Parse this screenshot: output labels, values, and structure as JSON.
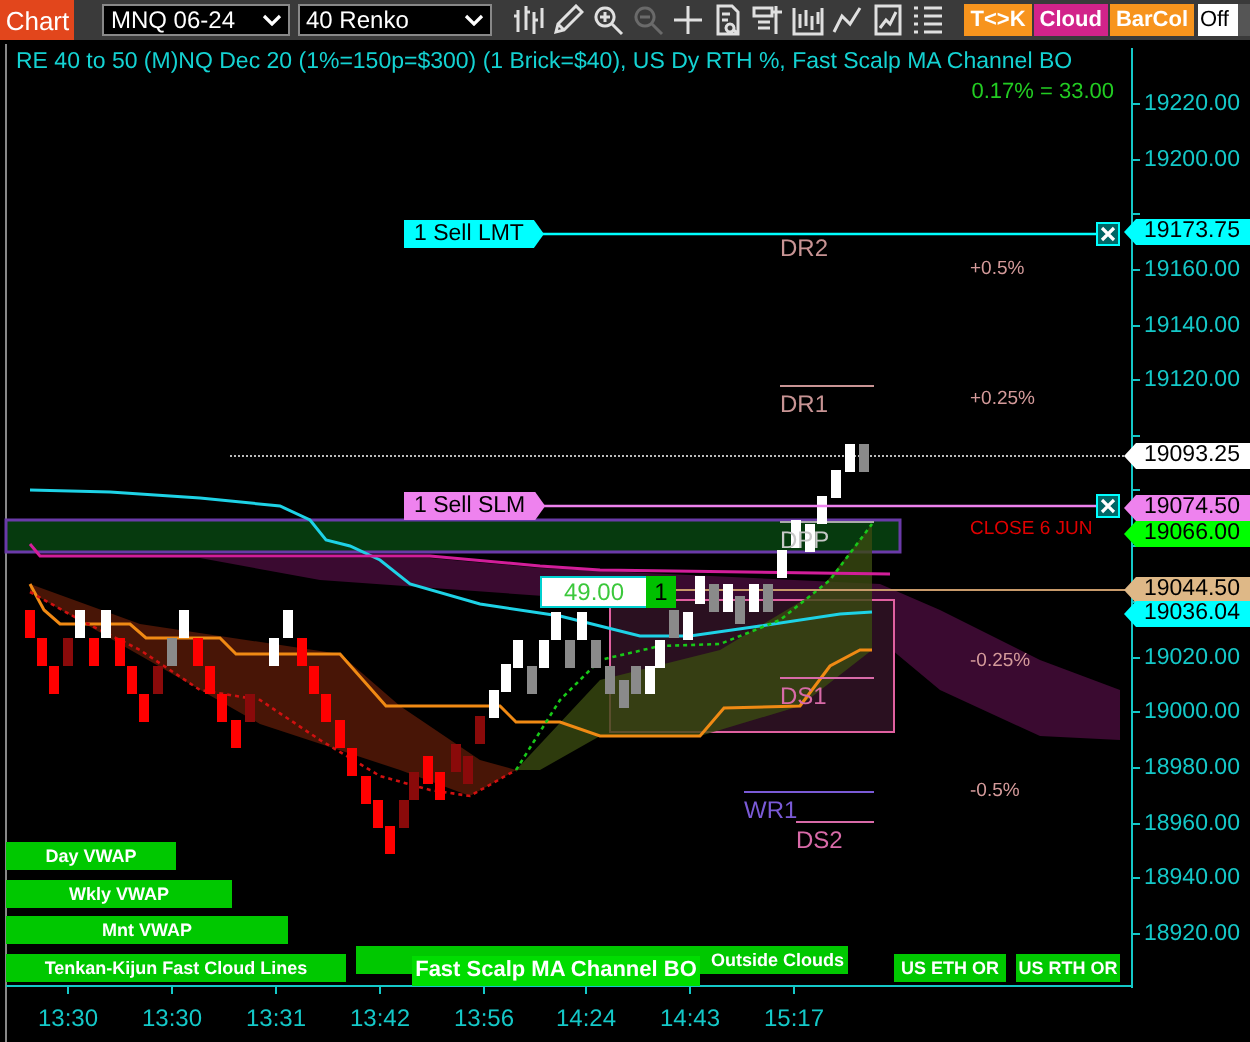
{
  "toolbar": {
    "app_button": "Chart",
    "instrument": "MNQ 06-24",
    "bar_type": "40 Renko",
    "tools": [
      {
        "kind": "bars",
        "disabled": false
      },
      {
        "kind": "pencil",
        "disabled": false
      },
      {
        "kind": "zoom-in",
        "disabled": false
      },
      {
        "kind": "zoom-out",
        "disabled": true
      },
      {
        "kind": "crosshair",
        "disabled": false
      },
      {
        "kind": "document-search",
        "disabled": false
      },
      {
        "kind": "data-box",
        "disabled": false
      },
      {
        "kind": "chart-box",
        "disabled": false
      },
      {
        "kind": "line-chart",
        "disabled": false
      },
      {
        "kind": "framed-chart",
        "disabled": false
      },
      {
        "kind": "list",
        "disabled": false
      }
    ],
    "toggles": [
      {
        "label": "T<>K",
        "color": "#f7941d"
      },
      {
        "label": "Cloud",
        "color": "#d2238a"
      },
      {
        "label": "BarCol",
        "color": "#f7941d"
      }
    ],
    "mode_select": "Off"
  },
  "chart": {
    "title": "RE 40 to 50 (M)NQ Dec 20 (1%=150p=$300) (1 Brick=$40), US Dy RTH %, Fast Scalp MA Channel BO",
    "change": "0.17% = 33.00",
    "price_axis": [
      "19220.00",
      "19200.00",
      "19160.00",
      "19140.00",
      "19120.00",
      "19020.00",
      "19000.00",
      "18980.00",
      "18960.00",
      "18940.00",
      "18920.00"
    ],
    "price_markers": [
      {
        "value": "19173.75",
        "color": "#00ffff"
      },
      {
        "value": "19093.25",
        "color": "#ffffff"
      },
      {
        "value": "19074.50",
        "color": "#ee82ee"
      },
      {
        "value": "19066.00",
        "color": "#00ff00"
      },
      {
        "value": "19044.50",
        "color": "#deb887"
      },
      {
        "value": "19036.04",
        "color": "#00ffff"
      }
    ],
    "orders": [
      {
        "label": "1 Sell LMT",
        "color": "#00ffff"
      },
      {
        "label": "1 Sell SLM",
        "color": "#ee82ee"
      }
    ],
    "levels": [
      {
        "label": "DR2",
        "color": "#c89494"
      },
      {
        "label": "DR1",
        "color": "#c89494"
      },
      {
        "label": "DPP",
        "color": "#c8c8c8"
      },
      {
        "label": "DS1",
        "color": "#d86aa8"
      },
      {
        "label": "WR1",
        "color": "#7a5ad6"
      },
      {
        "label": "DS2",
        "color": "#d86aa8"
      }
    ],
    "percent_labels": [
      {
        "text": "+0.5%",
        "color": "#d49a9a"
      },
      {
        "text": "+0.25%",
        "color": "#d49a9a"
      },
      {
        "text": "CLOSE 6 JUN",
        "color": "#e00000"
      },
      {
        "text": "-0.25%",
        "color": "#d49a9a"
      },
      {
        "text": "-0.5%",
        "color": "#d49a9a"
      }
    ],
    "quick_order": {
      "price": "49.00",
      "quantity": "1"
    },
    "indicator_labels": [
      "Day VWAP",
      "Wkly VWAP",
      "Mnt VWAP",
      "Tenkan-Kijun Fast Cloud Lines",
      "Outside Clouds",
      "Fast Scalp MA Channel BO",
      "US ETH OR",
      "US RTH OR"
    ],
    "time_axis": [
      "13:30",
      "13:30",
      "13:31",
      "13:42",
      "13:56",
      "14:24",
      "14:43",
      "15:17"
    ]
  }
}
